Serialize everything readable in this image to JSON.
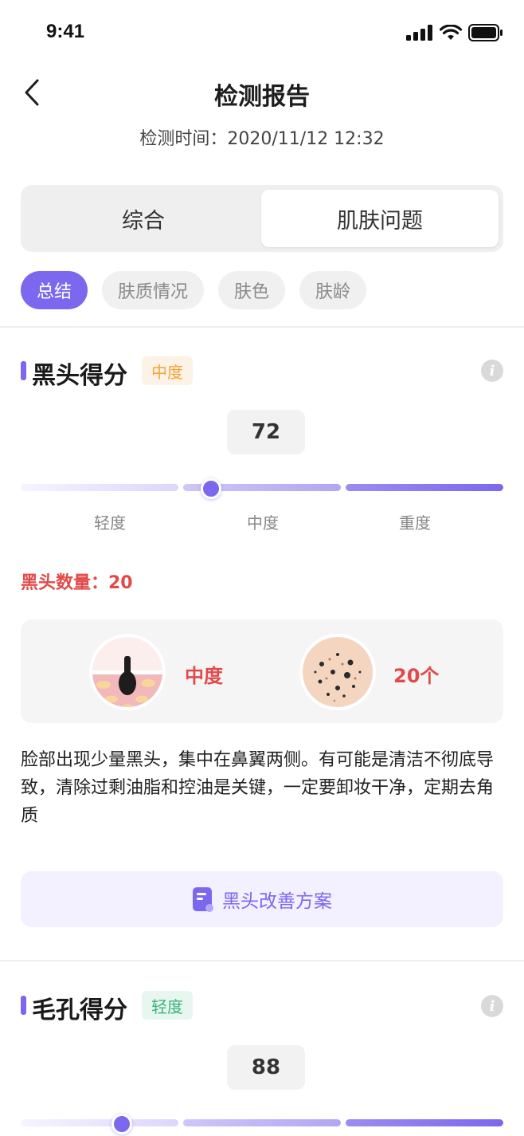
{
  "status": {
    "time": "9:41"
  },
  "nav": {
    "title": "检测报告",
    "subtitle": "检测时间：2020/11/12 12:32"
  },
  "segmented": {
    "items": [
      "综合",
      "肌肤问题"
    ],
    "active": 1
  },
  "chips": [
    "总结",
    "肤质情况",
    "肤色",
    "肤龄"
  ],
  "colors": {
    "accent": "#7b68ee",
    "danger": "#e24a4a",
    "moderate": "#f0a43a",
    "mild": "#3bb37b"
  },
  "levels": [
    "轻度",
    "中度",
    "重度"
  ],
  "blackhead": {
    "title": "黑头得分",
    "badge": "中度",
    "score": "72",
    "level_index": 1,
    "count_text": "黑头数量：20",
    "illu_left_label": "中度",
    "illu_right_label": "20个",
    "description": "脸部出现少量黑头，集中在鼻翼两侧。有可能是清洁不彻底导致，清除过剩油脂和控油是关键，一定要卸妆干净，定期去角质",
    "plan_label": "黑头改善方案"
  },
  "pore": {
    "title": "毛孔得分",
    "badge": "轻度",
    "score": "88",
    "level_index": 0
  }
}
